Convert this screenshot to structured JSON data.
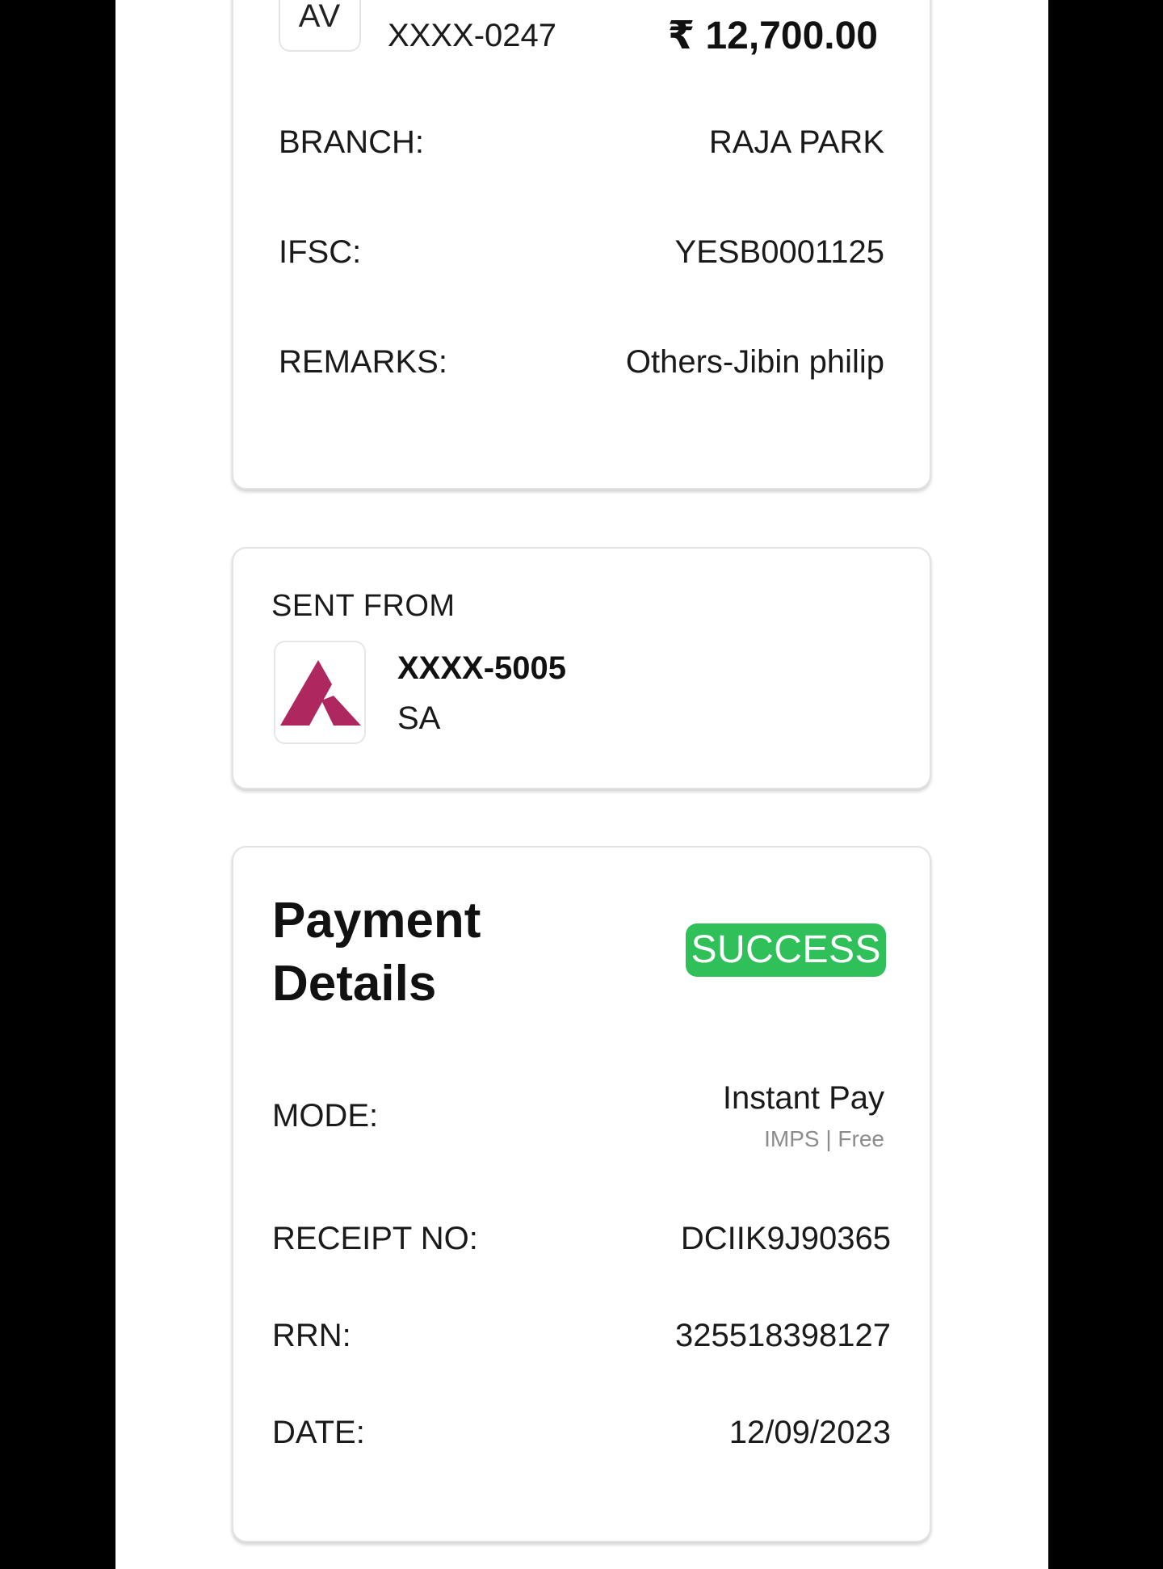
{
  "payee": {
    "avatar_initials": "AV",
    "account_masked": "XXXX-0247",
    "amount": "₹ 12,700.00",
    "details": [
      {
        "label": "BRANCH:",
        "value": "RAJA PARK"
      },
      {
        "label": "IFSC:",
        "value": "YESB0001125"
      },
      {
        "label": "REMARKS:",
        "value": "Others-Jibin philip"
      }
    ]
  },
  "sent_from": {
    "title": "SENT FROM",
    "account_masked": "XXXX-5005",
    "account_type": "SA",
    "logo_color": "#ae275f"
  },
  "payment_details": {
    "title_line1": "Payment",
    "title_line2": "Details",
    "status": "SUCCESS",
    "status_color": "#2fc05a",
    "mode_label": "MODE:",
    "mode_value": "Instant Pay",
    "mode_sub": "IMPS | Free",
    "rows": [
      {
        "label": "RECEIPT NO:",
        "value": "DCIIK9J90365"
      },
      {
        "label": "RRN:",
        "value": "325518398127"
      },
      {
        "label": "DATE:",
        "value": "12/09/2023"
      }
    ]
  }
}
